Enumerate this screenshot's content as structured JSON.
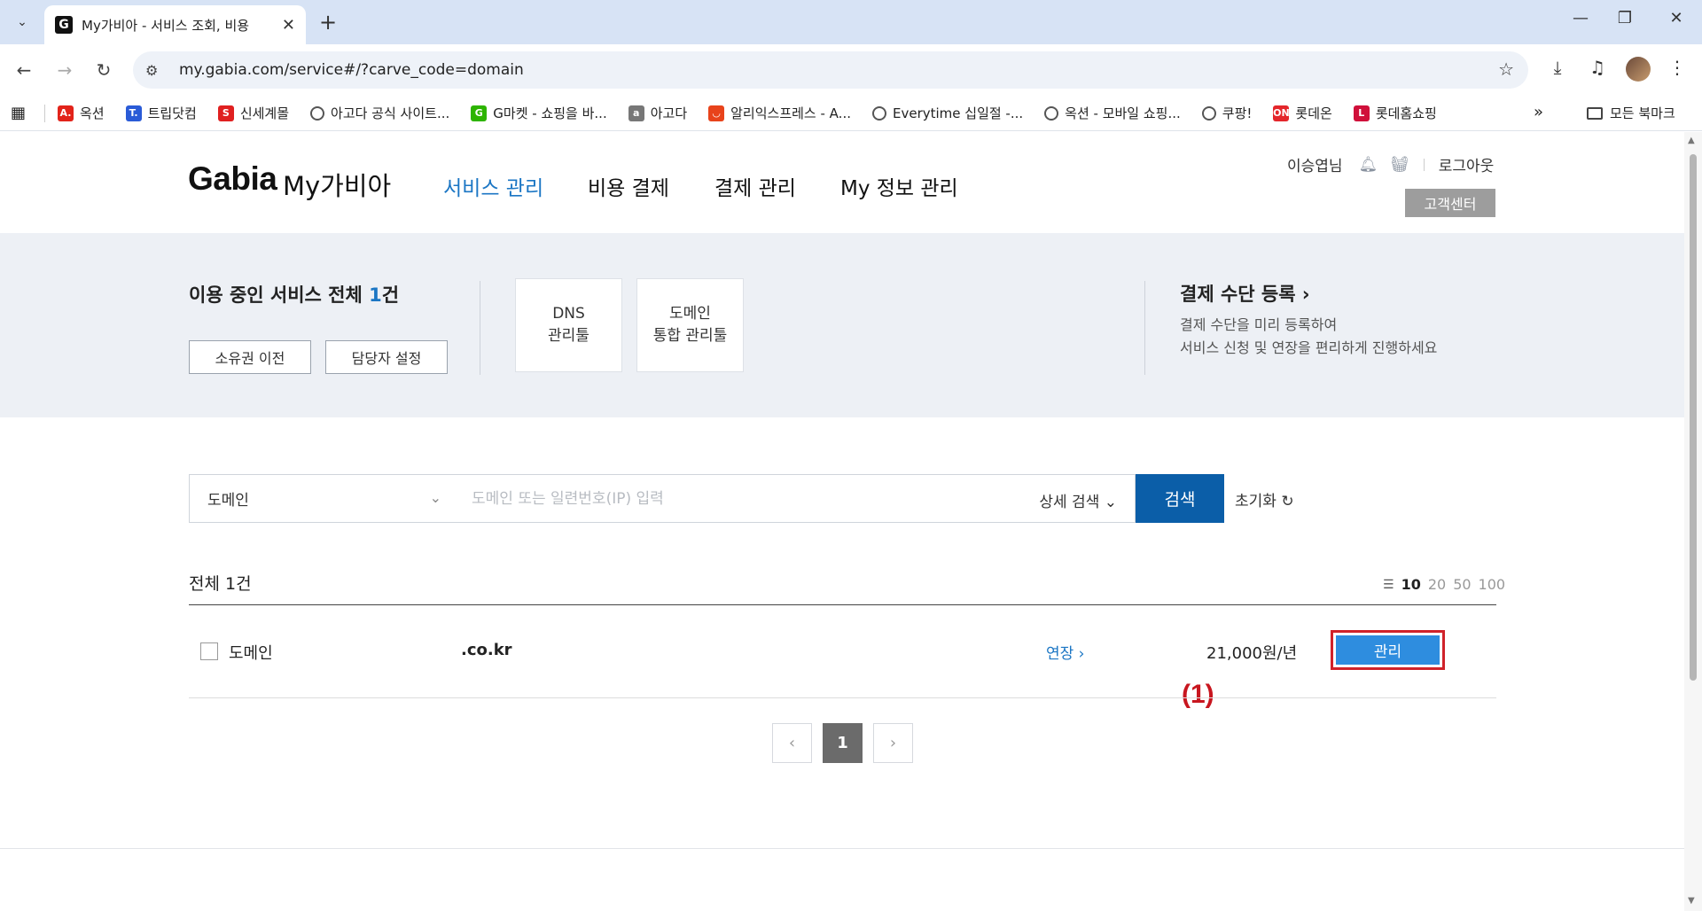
{
  "browser": {
    "tab_title": "My가비아 - 서비스 조회, 비용",
    "tab_favicon": "G",
    "url": "my.gabia.com/service#/?carve_code=domain",
    "bookmarks": [
      {
        "label": "옥션",
        "icon": "A.",
        "color": "#e2231a"
      },
      {
        "label": "트립닷컴",
        "icon": "T.",
        "color": "#2a5bd7"
      },
      {
        "label": "신세계몰",
        "icon": "S",
        "color": "#e02020"
      },
      {
        "label": "아고다 공식 사이트...",
        "icon": "globe-icon",
        "color": "#555555"
      },
      {
        "label": "G마켓 - 쇼핑을 바...",
        "icon": "G",
        "color": "#2db400"
      },
      {
        "label": "아고다",
        "icon": "a",
        "color": "#777777"
      },
      {
        "label": "알리익스프레스 - A...",
        "icon": "ali",
        "color": "#e8431b"
      },
      {
        "label": "Everytime 십일절 -...",
        "icon": "globe-icon",
        "color": "#555555"
      },
      {
        "label": "옥션 - 모바일 쇼핑...",
        "icon": "globe-icon",
        "color": "#555555"
      },
      {
        "label": "쿠팡!",
        "icon": "globe-icon",
        "color": "#555555"
      },
      {
        "label": "롯데온",
        "icon": "ON",
        "color": "#e4262b"
      },
      {
        "label": "롯데홈쇼핑",
        "icon": "L",
        "color": "#d0103a"
      }
    ],
    "bookmarks_more": "»",
    "all_bookmarks": "모든 북마크"
  },
  "header": {
    "logo": "Gabia",
    "logo_sub": "My가비아",
    "nav": [
      "서비스 관리",
      "비용 결제",
      "결제 관리",
      "My 정보 관리"
    ],
    "active_nav": "서비스 관리",
    "user_name": "이승엽님",
    "logout": "로그아웃",
    "customer_center": "고객센터"
  },
  "summary": {
    "title_prefix": "이용 중인 서비스 전체 ",
    "count": "1",
    "title_suffix": "건",
    "transfer_button": "소유권 이전",
    "manager_button": "담당자 설정",
    "tools": [
      {
        "line1": "DNS",
        "line2": "관리툴"
      },
      {
        "line1": "도메인",
        "line2": "통합 관리툴"
      }
    ],
    "payment_title": "결제 수단 등록 ›",
    "payment_desc_line1": "결제 수단을 미리 등록하여",
    "payment_desc_line2": "서비스 신청 및 연장을 편리하게 진행하세요"
  },
  "search": {
    "category": "도메인",
    "placeholder": "도메인 또는 일련번호(IP) 입력",
    "advanced": "상세 검색",
    "button": "검색",
    "reset": "초기화"
  },
  "list": {
    "total": "전체 1건",
    "page_sizes": [
      "10",
      "20",
      "50",
      "100"
    ],
    "selected_page_size": "10",
    "rows": [
      {
        "type": "도메인",
        "domain": ".co.kr",
        "renew": "연장 ›",
        "price": "21,000원/년",
        "action": "관리"
      }
    ],
    "annotation": "(1)"
  },
  "pagination": {
    "prev": "‹",
    "current": "1",
    "next": "›"
  },
  "colors": {
    "brand_blue": "#1b76c4",
    "search_button": "#0b5ea8",
    "manage_button": "#2e8ddf",
    "highlight_red": "#d0222a"
  }
}
